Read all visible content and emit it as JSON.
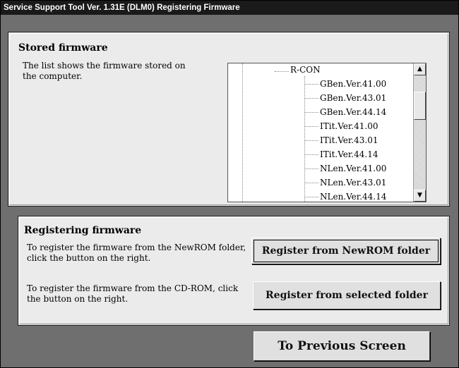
{
  "window": {
    "title": "Service Support Tool Ver. 1.31E (DLM0)   Registering Firmware"
  },
  "stored_firmware": {
    "heading": "Stored firmware",
    "description": "The list shows the firmware stored on the computer.",
    "tree": {
      "parent": "R-CON",
      "items": [
        "GBen.Ver.41.00",
        "GBen.Ver.43.01",
        "GBen.Ver.44.14",
        "ITit.Ver.41.00",
        "ITit.Ver.43.01",
        "ITit.Ver.44.14",
        "NLen.Ver.41.00",
        "NLen.Ver.43.01",
        "NLen.Ver.44.14"
      ]
    },
    "scroll_up_icon": "arrow-up",
    "scroll_down_icon": "arrow-down"
  },
  "registering": {
    "heading": "Registering firmware",
    "newrom_description": "To register the firmware from the NewROM folder, click the button on the right.",
    "newrom_button": "Register from NewROM folder",
    "cdrom_description": "To register the firmware from the CD-ROM, click the button on the right.",
    "selected_button": "Register from selected folder"
  },
  "footer": {
    "previous_button": "To Previous Screen"
  }
}
